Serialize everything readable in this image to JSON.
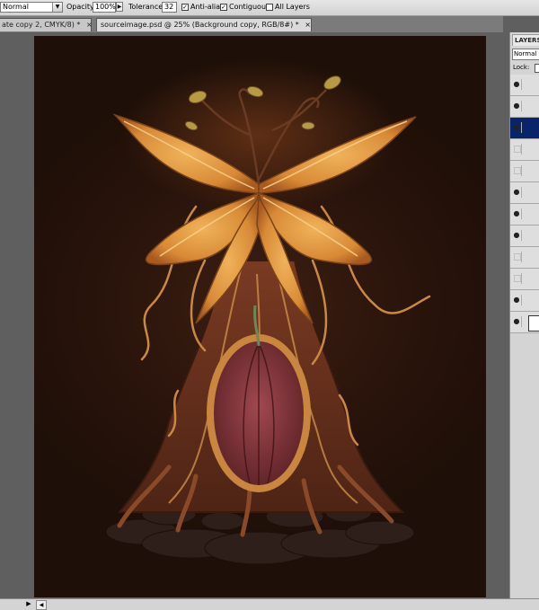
{
  "options_bar": {
    "mode": "Normal",
    "opacity_label": "Opacity:",
    "opacity_value": "100%",
    "tolerance_label": "Tolerance:",
    "tolerance_value": "32",
    "anti_alias_label": "Anti-alias",
    "anti_alias_checked": true,
    "contiguous_label": "Contiguous",
    "contiguous_checked": true,
    "all_layers_label": "All Layers",
    "all_layers_checked": false
  },
  "tabs": [
    {
      "label": "ate copy 2, CMYK/8) *",
      "active": false
    },
    {
      "label": "sourceimage.psd @ 25% (Background copy, RGB/8#) *",
      "active": true
    }
  ],
  "layers_panel": {
    "title": "LAYERS",
    "blend_mode": "Normal",
    "lock_label": "Lock:",
    "rows": [
      {
        "visible": true,
        "selected": false
      },
      {
        "visible": true,
        "selected": false
      },
      {
        "visible": true,
        "selected": true
      },
      {
        "visible": false,
        "selected": false
      },
      {
        "visible": false,
        "selected": false
      },
      {
        "visible": true,
        "selected": false
      },
      {
        "visible": true,
        "selected": false
      },
      {
        "visible": true,
        "selected": false
      },
      {
        "visible": false,
        "selected": false
      },
      {
        "visible": false,
        "selected": false
      },
      {
        "visible": true,
        "selected": false
      },
      {
        "visible": true,
        "selected": false
      }
    ]
  },
  "icons": {
    "eye": "eye-icon",
    "dropdown": "chevron-down-icon",
    "flyout": "triangle-right-icon",
    "play": "play-icon"
  },
  "colors": {
    "selection": "#0a246a",
    "canvas_bg": "#2a140b",
    "petal": "#e0a04a",
    "trunk": "#6e3520",
    "pod": "#8a3a3e"
  }
}
